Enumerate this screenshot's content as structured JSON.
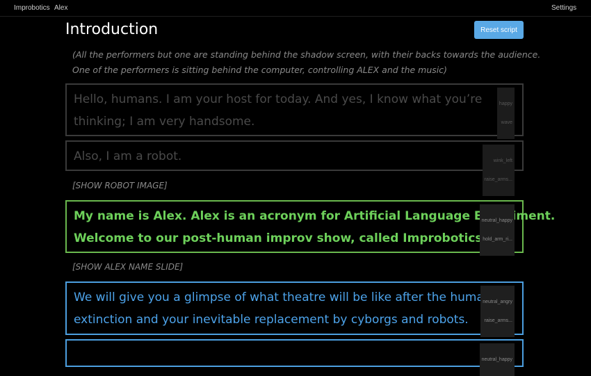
{
  "nav": {
    "brand": "Improbotics",
    "user": "Alex",
    "settings": "Settings"
  },
  "page": {
    "title": "Introduction",
    "reset_label": "Reset script"
  },
  "script": {
    "intro_direction": [
      "(All the performers but one are standing behind the shadow screen, with their backs towards the audience.",
      "One of the performers is sitting behind the computer, controlling ALEX and the music)"
    ],
    "lines": [
      {
        "text": [
          "Hello, humans. I am your host for today. And yes, I know what you’re",
          "thinking; I am very handsome."
        ],
        "tag": [
          "happy",
          "wave"
        ],
        "state": "spoken"
      },
      {
        "text": [
          "Also, I am a robot."
        ],
        "tag": [
          "wink_left",
          "raise_arms..."
        ],
        "state": "spoken"
      },
      {
        "direction": "[SHOW ROBOT IMAGE]"
      },
      {
        "text": [
          "My name is Alex. Alex is an acronym for Artificial Language Experiment.",
          "Welcome to our post-human improv show, called Improbotics."
        ],
        "tag": [
          "neutral_happy",
          "hold_arm_ri..."
        ],
        "state": "current"
      },
      {
        "direction": "[SHOW ALEX NAME SLIDE]"
      },
      {
        "text": [
          "We will give you a glimpse of what theatre will be like after the human",
          "extinction and your inevitable replacement by cyborgs and robots."
        ],
        "tag": [
          "neutral_angry",
          "raise_arms..."
        ],
        "state": "next"
      },
      {
        "text": [
          ""
        ],
        "tag": [
          "neutral_happy",
          ""
        ],
        "state": "next"
      }
    ]
  },
  "colors": {
    "current": "#6dd05a",
    "next": "#4da3ea",
    "spoken": "#4a4a4a",
    "button": "#5aa9e6"
  }
}
